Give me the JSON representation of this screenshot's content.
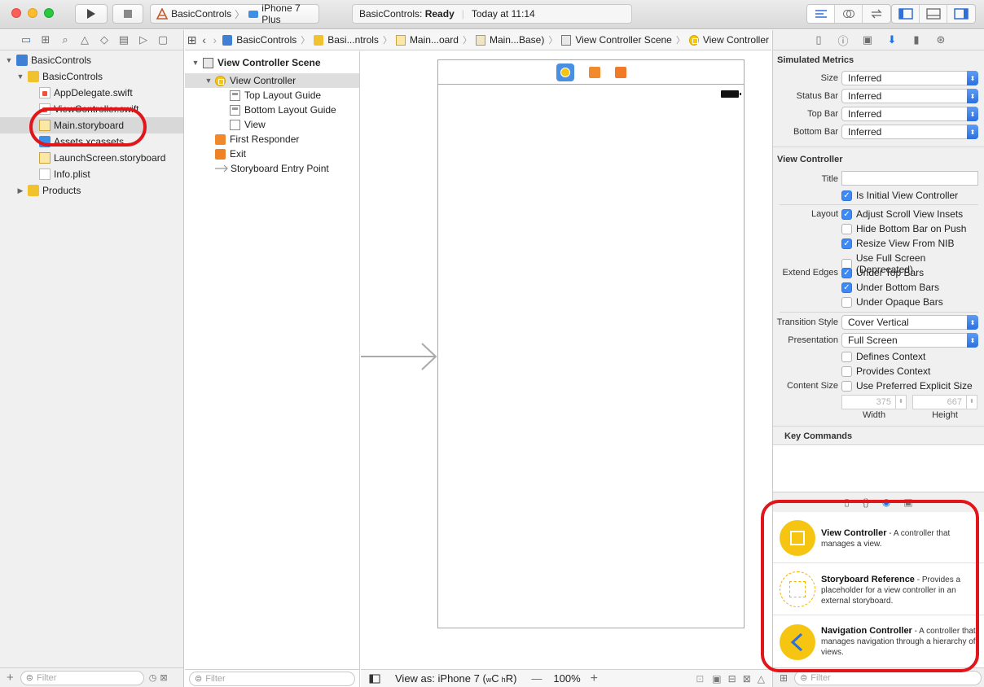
{
  "toolbar": {
    "scheme_project": "BasicControls",
    "scheme_device": "iPhone 7 Plus",
    "status_project": "BasicControls:",
    "status_state": "Ready",
    "status_time": "Today at 11:14"
  },
  "navigator": {
    "items": [
      {
        "label": "BasicControls"
      },
      {
        "label": "BasicControls"
      },
      {
        "label": "AppDelegate.swift"
      },
      {
        "label": "ViewController.swift"
      },
      {
        "label": "Main.storyboard"
      },
      {
        "label": "Assets.xcassets"
      },
      {
        "label": "LaunchScreen.storyboard"
      },
      {
        "label": "Info.plist"
      },
      {
        "label": "Products"
      }
    ],
    "filter_placeholder": "Filter"
  },
  "jumpbar": {
    "crumbs": [
      "BasicControls",
      "Basi...ntrols",
      "Main...oard",
      "Main...Base)",
      "View Controller Scene",
      "View Controller"
    ]
  },
  "outline": {
    "scene": "View Controller Scene",
    "items": [
      {
        "label": "View Controller"
      },
      {
        "label": "Top Layout Guide"
      },
      {
        "label": "Bottom Layout Guide"
      },
      {
        "label": "View"
      },
      {
        "label": "First Responder"
      },
      {
        "label": "Exit"
      },
      {
        "label": "Storyboard Entry Point"
      }
    ],
    "filter_placeholder": "Filter"
  },
  "canvas": {
    "view_as": "View as: iPhone 7 (",
    "size_class_w": "w",
    "size_class_c": "C",
    "size_class_h": "h",
    "size_class_r": "R)",
    "zoom": "100%",
    "zoom_out": "—",
    "zoom_in": "+"
  },
  "inspector": {
    "simulated_metrics": {
      "title": "Simulated Metrics",
      "rows": [
        {
          "label": "Size",
          "value": "Inferred"
        },
        {
          "label": "Status Bar",
          "value": "Inferred"
        },
        {
          "label": "Top Bar",
          "value": "Inferred"
        },
        {
          "label": "Bottom Bar",
          "value": "Inferred"
        }
      ]
    },
    "view_controller": {
      "title": "View Controller",
      "title_label": "Title",
      "title_value": "",
      "is_initial": "Is Initial View Controller",
      "layout_label": "Layout",
      "layout_opts": [
        "Adjust Scroll View Insets",
        "Hide Bottom Bar on Push",
        "Resize View From NIB",
        "Use Full Screen (Deprecated)"
      ],
      "extend_label": "Extend Edges",
      "extend_opts": [
        "Under Top Bars",
        "Under Bottom Bars",
        "Under Opaque Bars"
      ],
      "transition_label": "Transition Style",
      "transition_value": "Cover Vertical",
      "presentation_label": "Presentation",
      "presentation_value": "Full Screen",
      "defines_context": "Defines Context",
      "provides_context": "Provides Context",
      "content_size_label": "Content Size",
      "use_preferred": "Use Preferred Explicit Size",
      "width_value": "375",
      "height_value": "667",
      "width_label": "Width",
      "height_label": "Height"
    },
    "key_commands": "Key Commands",
    "library": [
      {
        "title": "View Controller",
        "desc": " - A controller that manages a view."
      },
      {
        "title": "Storyboard Reference",
        "desc": " - Provides a placeholder for a view controller in an external storyboard."
      },
      {
        "title": "Navigation Controller",
        "desc": " - A controller that manages navigation through a hierarchy of views."
      }
    ],
    "filter_placeholder": "Filter"
  }
}
